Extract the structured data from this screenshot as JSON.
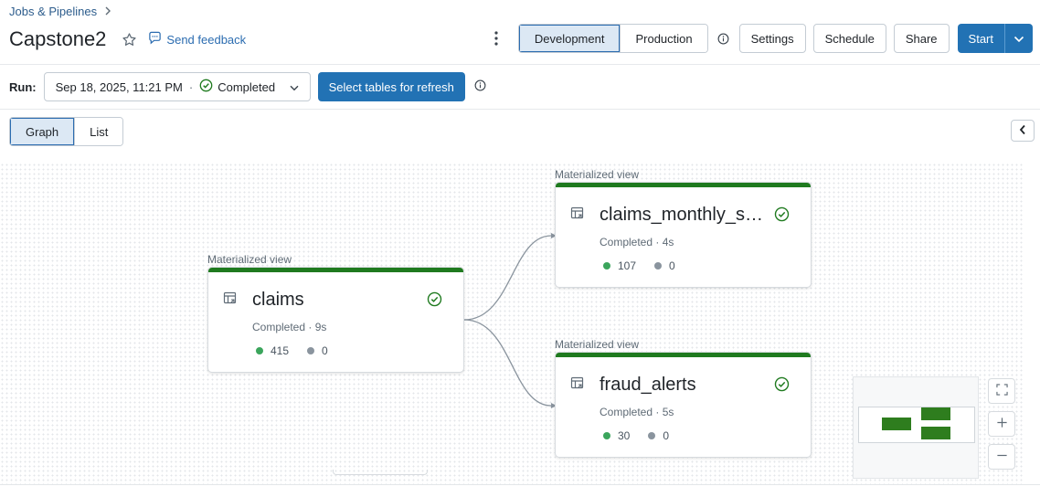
{
  "breadcrumb": {
    "label": "Jobs & Pipelines"
  },
  "page": {
    "title": "Capstone2",
    "feedback_label": "Send feedback"
  },
  "mode_toggle": {
    "development": "Development",
    "production": "Production",
    "active": "Development"
  },
  "actions": {
    "settings": "Settings",
    "schedule": "Schedule",
    "share": "Share",
    "start": "Start"
  },
  "run": {
    "label": "Run:",
    "date": "Sep 18, 2025, 11:21 PM",
    "separator": "·",
    "status": "Completed",
    "refresh_label": "Select tables for refresh"
  },
  "view_toggle": {
    "graph": "Graph",
    "list": "List",
    "active": "Graph"
  },
  "nodes": [
    {
      "type_label": "Materialized view",
      "name": "claims",
      "meta": "Completed · 9s",
      "rows_written": "415",
      "rows_dropped": "0"
    },
    {
      "type_label": "Materialized view",
      "name": "claims_monthly_su...",
      "meta": "Completed · 4s",
      "rows_written": "107",
      "rows_dropped": "0"
    },
    {
      "type_label": "Materialized view",
      "name": "fraud_alerts",
      "meta": "Completed · 5s",
      "rows_written": "30",
      "rows_dropped": "0"
    }
  ],
  "colors": {
    "primary": "#2272b4",
    "success": "#1f7a1f",
    "success_dot": "#3ba55c",
    "muted_dot": "#8a949e",
    "link": "#2b6cb0"
  },
  "icons": [
    "chevron-right-icon",
    "star-icon",
    "feedback-icon",
    "kebab-icon",
    "info-icon",
    "chevron-down-icon",
    "check-circle-icon",
    "table-icon",
    "collapse-panel-icon",
    "fit-view-icon",
    "zoom-in-icon",
    "zoom-out-icon"
  ]
}
